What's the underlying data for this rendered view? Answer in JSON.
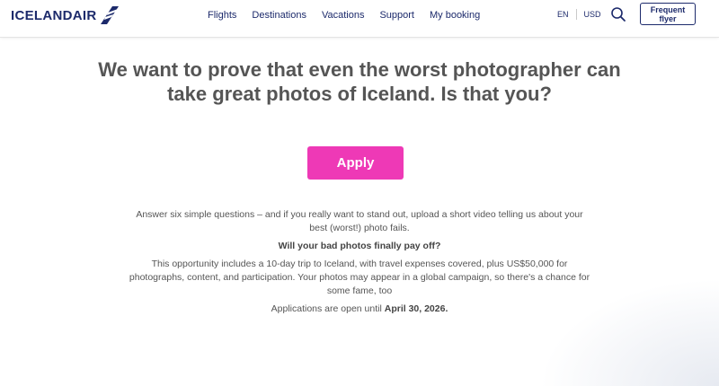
{
  "brand": {
    "logo_text": "ICELANDAIR",
    "primary_color": "#1c2a6b",
    "accent_color": "#ee39b6"
  },
  "nav": {
    "items": [
      {
        "label": "Flights"
      },
      {
        "label": "Destinations"
      },
      {
        "label": "Vacations"
      },
      {
        "label": "Support"
      },
      {
        "label": "My booking"
      }
    ]
  },
  "locale": {
    "language": "EN",
    "currency": "USD"
  },
  "header_actions": {
    "search_icon": "search-icon",
    "frequent_flyer_label": "Frequent flyer"
  },
  "main": {
    "headline": "We want to prove that even the worst photographer can take great photos of Iceland. Is that you?",
    "apply_label": "Apply",
    "intro": "Answer six simple questions – and if you really want to stand out, upload a short video telling us about your best (worst!) photo fails.",
    "question": "Will your bad photos finally pay off?",
    "details": "This opportunity includes a 10-day trip to Iceland, with travel expenses covered, plus US$50,000 for photographs, content, and participation. Your photos may appear in a global campaign, so there's a chance for some fame, too",
    "deadline_prefix": "Applications are open until ",
    "deadline_date": "April 30, 2026."
  }
}
